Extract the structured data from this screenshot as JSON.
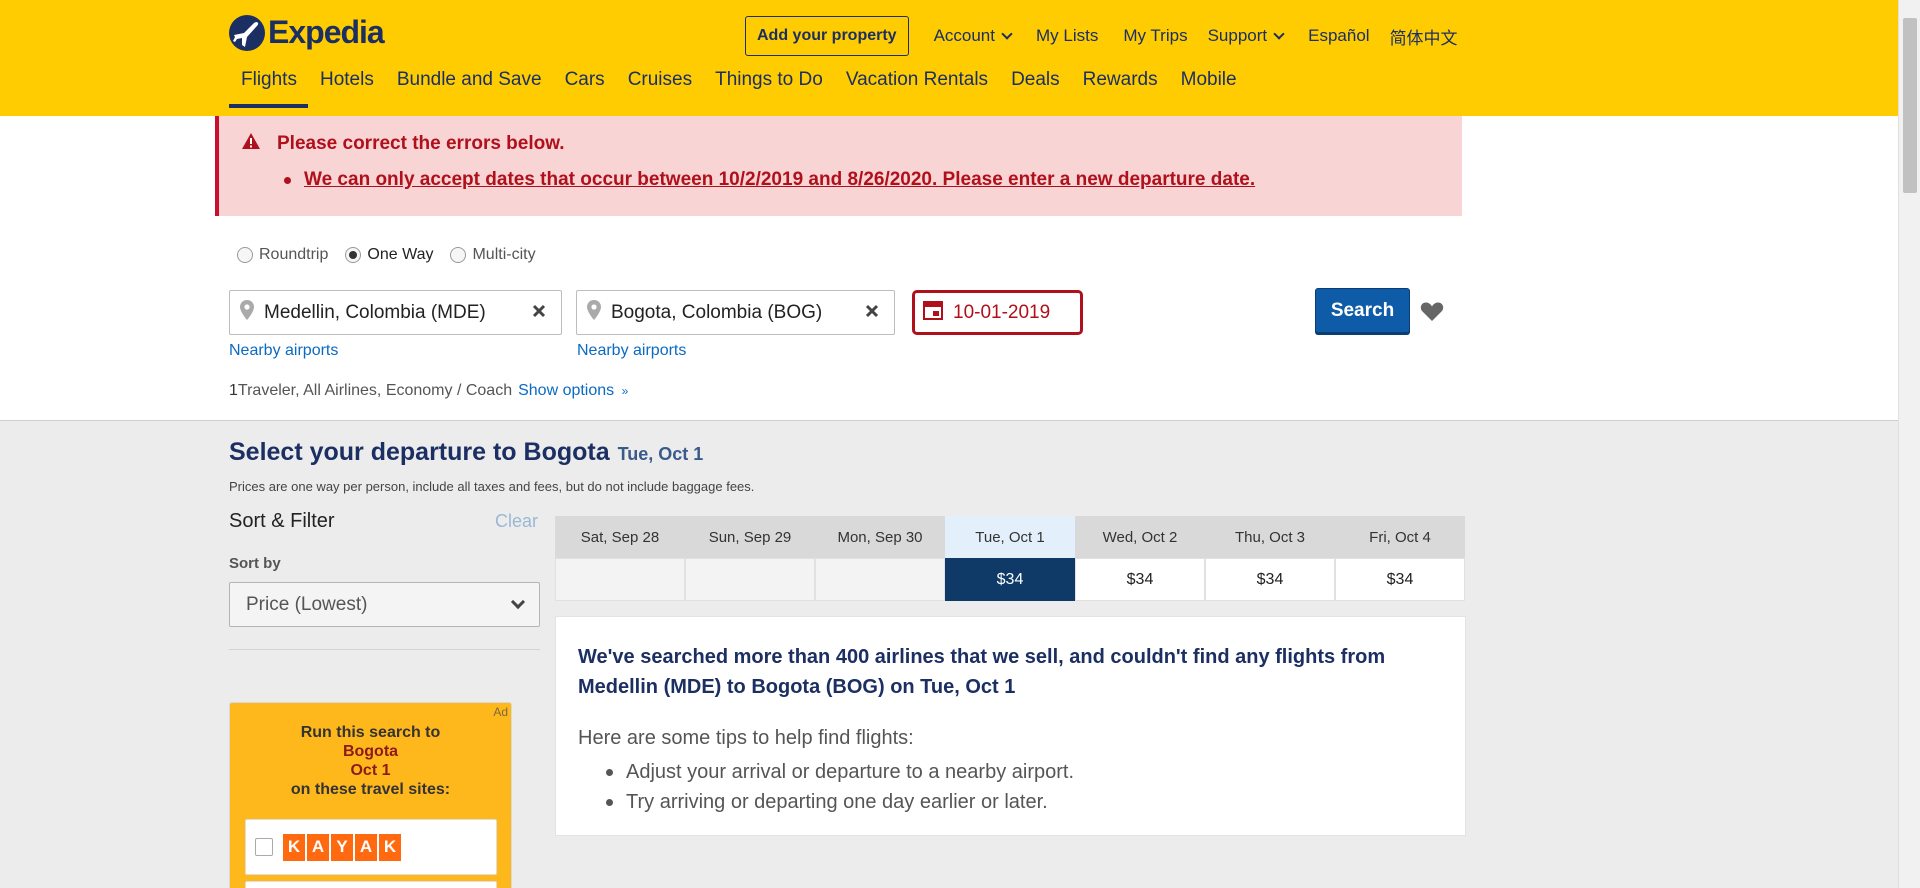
{
  "header": {
    "logo_text": "Expedia",
    "add_property": "Add your property",
    "account": "Account",
    "my_lists": "My Lists",
    "my_trips": "My Trips",
    "support": "Support",
    "lang_es": "Español",
    "lang_zh": "简体中文",
    "tabs": [
      "Flights",
      "Hotels",
      "Bundle and Save",
      "Cars",
      "Cruises",
      "Things to Do",
      "Vacation Rentals",
      "Deals",
      "Rewards",
      "Mobile"
    ]
  },
  "error": {
    "title": "Please correct the errors below.",
    "message": "We can only accept dates that occur between 10/2/2019 and 8/26/2020. Please enter a new departure date."
  },
  "search": {
    "trip_types": [
      "Roundtrip",
      "One Way",
      "Multi-city"
    ],
    "from": "Medellin, Colombia (MDE)",
    "to": "Bogota, Colombia (BOG)",
    "date": "10-01-2019",
    "nearby_from": "Nearby airports",
    "nearby_to": "Nearby airports",
    "search_button": "Search",
    "traveler_count": "1",
    "traveler_text": " Traveler, All Airlines, Economy / Coach",
    "show_options": "Show options"
  },
  "results": {
    "title": "Select your departure to Bogota",
    "date": "Tue, Oct 1",
    "price_note": "Prices are one way per person, include all taxes and fees, but do not include baggage fees.",
    "dates": [
      {
        "label": "Sat, Sep 28",
        "price": ""
      },
      {
        "label": "Sun, Sep 29",
        "price": ""
      },
      {
        "label": "Mon, Sep 30",
        "price": ""
      },
      {
        "label": "Tue, Oct 1",
        "price": "$34"
      },
      {
        "label": "Wed, Oct 2",
        "price": "$34"
      },
      {
        "label": "Thu, Oct 3",
        "price": "$34"
      },
      {
        "label": "Fri, Oct 4",
        "price": "$34"
      }
    ],
    "no_flights_title": "We've searched more than 400 airlines that we sell, and couldn't find any flights from Medellin (MDE) to Bogota (BOG) on Tue, Oct 1",
    "tips_intro": "Here are some tips to help find flights:",
    "tips": [
      "Adjust your arrival or departure to a nearby airport.",
      "Try arriving or departing one day earlier or later."
    ]
  },
  "filters": {
    "heading": "Sort & Filter",
    "clear": "Clear",
    "sort_label": "Sort by",
    "sort_value": "Price (Lowest)"
  },
  "ad": {
    "tag": "Ad",
    "line1": "Run this search to",
    "line2": "Bogota",
    "line3": "Oct 1",
    "line4": "on these travel sites:",
    "kayak": [
      "K",
      "A",
      "Y",
      "A",
      "K"
    ]
  },
  "colors": {
    "header_bg": "#fecc00",
    "brand_navy": "#1c2f63",
    "error_red": "#b0101b",
    "search_blue": "#0e5ca8"
  }
}
